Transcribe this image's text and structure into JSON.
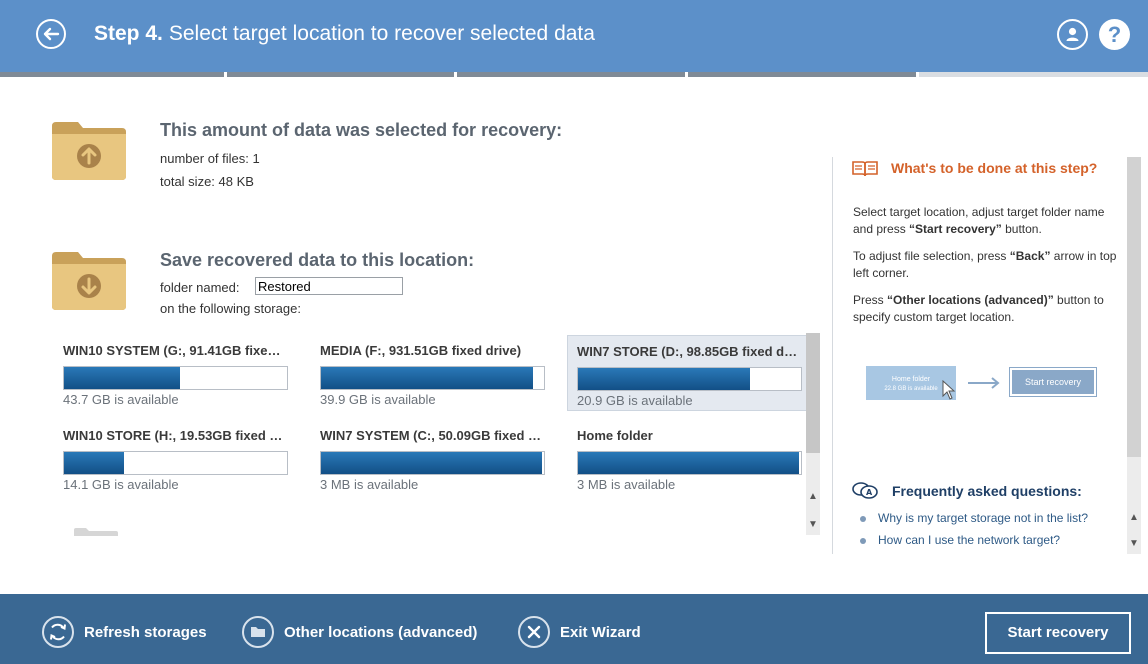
{
  "header": {
    "step_label": "Step 4.",
    "title": "Select target location to recover selected data",
    "help_label": "?"
  },
  "progress": {
    "completed_fraction": 0.8,
    "steps": 5
  },
  "selection": {
    "title": "This amount of data was selected for recovery:",
    "files_line": "number of files: 1",
    "size_line": "total size: 48 KB"
  },
  "save": {
    "title": "Save recovered data to this location:",
    "folder_label": "folder named:",
    "folder_value": "Restored",
    "storage_label": "on the following storage:"
  },
  "storages": [
    {
      "name": "WIN10 SYSTEM (G:, 91.41GB fixed ...",
      "available": "43.7 GB is available",
      "used_fraction": 0.52,
      "selected": false
    },
    {
      "name": "MEDIA (F:, 931.51GB fixed drive)",
      "available": "39.9 GB is available",
      "used_fraction": 0.95,
      "selected": false
    },
    {
      "name": "WIN7 STORE (D:, 98.85GB fixed dri...",
      "available": "20.9 GB is available",
      "used_fraction": 0.77,
      "selected": true
    },
    {
      "name": "WIN10 STORE (H:, 19.53GB fixed d...",
      "available": "14.1 GB is available",
      "used_fraction": 0.27,
      "selected": false
    },
    {
      "name": "WIN7 SYSTEM (C:, 50.09GB fixed dr...",
      "available": "3 MB is available",
      "used_fraction": 0.99,
      "selected": false
    },
    {
      "name": "Home folder",
      "available": "3 MB is available",
      "used_fraction": 0.99,
      "selected": false
    }
  ],
  "help": {
    "title": "What's to be done at this step?",
    "p1_pre": "Select target location, adjust target folder name and press ",
    "p1_bold": "“Start recovery”",
    "p1_post": " button.",
    "p2_pre": "To adjust file selection, press ",
    "p2_bold": "“Back”",
    "p2_post": " arrow in top left corner.",
    "p3_pre": "Press ",
    "p3_bold": "“Other locations (advanced)”",
    "p3_post": " button to specify custom target location.",
    "illustration": {
      "home_title": "Home folder",
      "home_sub": "22.8 GB is available",
      "start_label": "Start recovery"
    }
  },
  "faq": {
    "title": "Frequently asked questions:",
    "items": [
      "Why is my target storage not in the list?",
      "How can I use the network target?"
    ]
  },
  "footer": {
    "refresh_label": "Refresh storages",
    "other_label": "Other locations (advanced)",
    "exit_label": "Exit Wizard",
    "start_label": "Start recovery"
  },
  "colors": {
    "header_bg": "#5c90c9",
    "footer_bg": "#3a6893",
    "accent_orange": "#d4622a",
    "bar_fill": "#1a5f9a"
  }
}
